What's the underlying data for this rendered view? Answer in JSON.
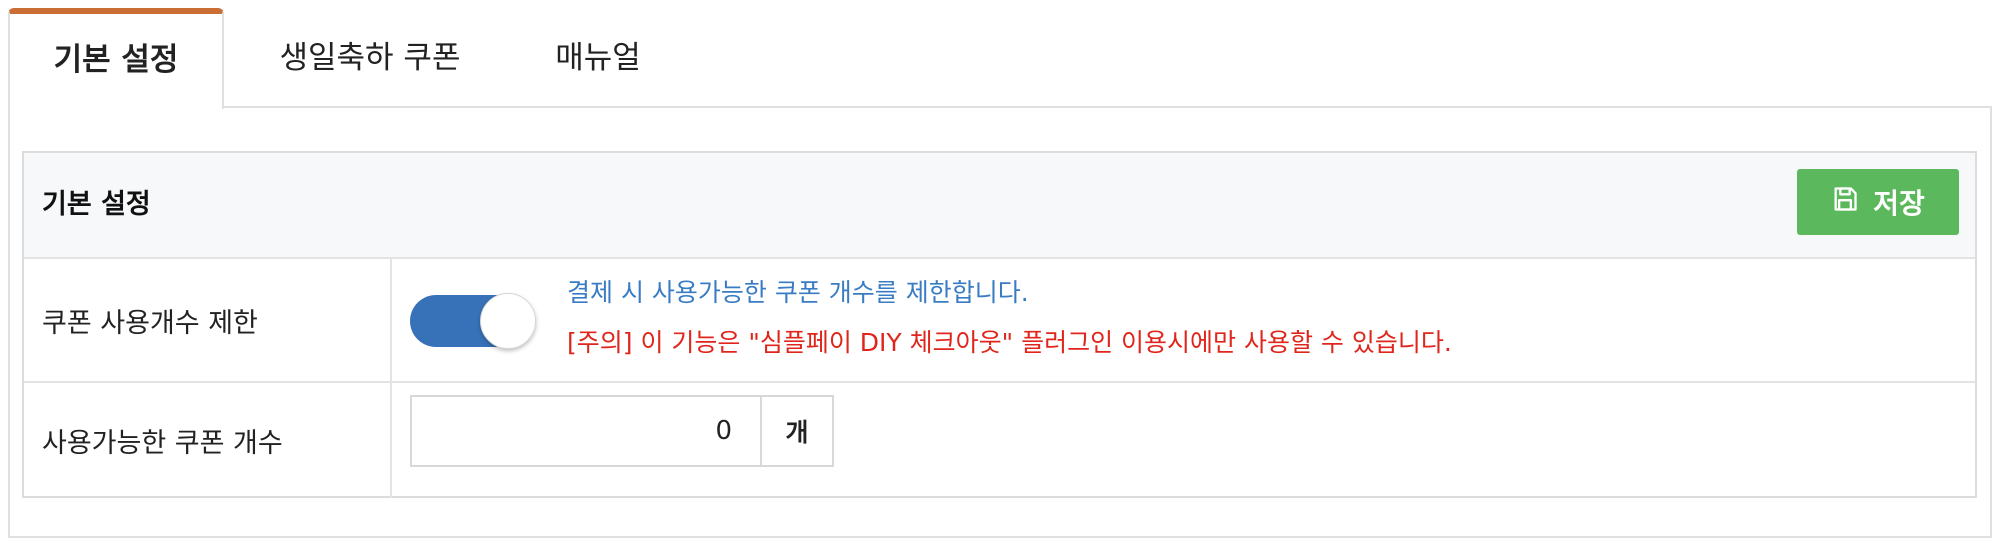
{
  "tabs": [
    {
      "label": "기본 설정",
      "active": true
    },
    {
      "label": "생일축하 쿠폰",
      "active": false
    },
    {
      "label": "매뉴얼",
      "active": false
    }
  ],
  "section": {
    "title": "기본 설정",
    "save_label": "저장",
    "save_icon": "floppy-disk-icon"
  },
  "coupon_limit": {
    "label": "쿠폰 사용개수 제한",
    "enabled": true,
    "description": "결제 시 사용가능한 쿠폰 개수를 제한합니다.",
    "warning": "[주의] 이 기능은 \"심플페이 DIY 체크아웃\" 플러그인 이용시에만 사용할 수 있습니다."
  },
  "coupon_count": {
    "label": "사용가능한 쿠폰 개수",
    "value": "0",
    "unit": "개"
  },
  "colors": {
    "accent_tab": "#c96f35",
    "save_button": "#5cb85c",
    "toggle_on": "#3772b8",
    "info_text": "#3a7cc4",
    "warning_text": "#e0261c"
  }
}
